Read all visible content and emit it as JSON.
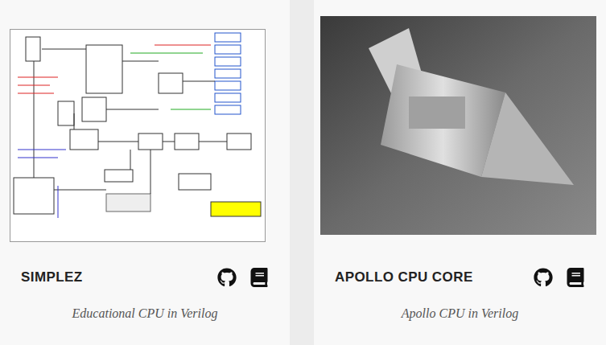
{
  "cards": [
    {
      "title": "SIMPLEZ",
      "subtitle": "Educational CPU in Verilog",
      "kind": "diagram"
    },
    {
      "title": "APOLLO CPU CORE",
      "subtitle": "Apollo CPU in Verilog",
      "kind": "photo"
    }
  ]
}
